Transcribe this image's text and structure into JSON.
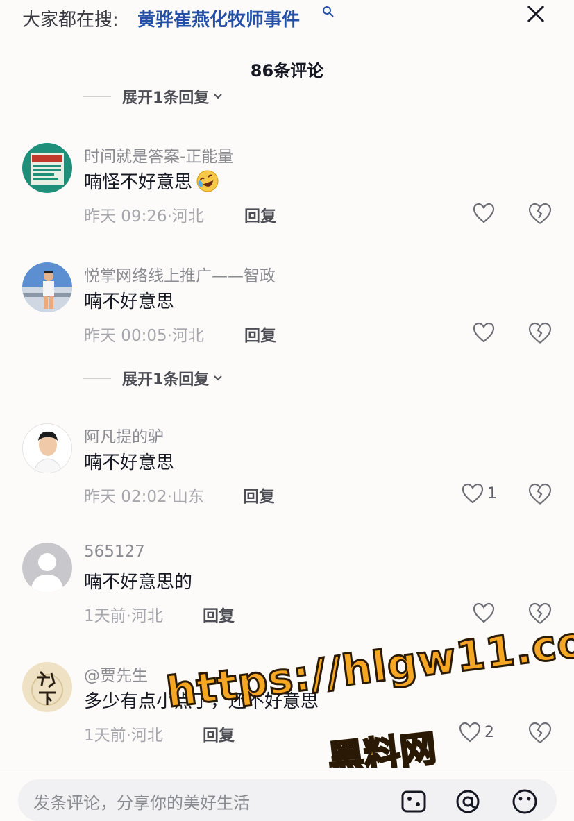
{
  "header": {
    "search_prefix": "大家都在搜:",
    "search_term": "黄骅崔燕化牧师事件",
    "comment_count": "86条评论"
  },
  "top_expand": {
    "label": "展开1条回复"
  },
  "comments": [
    {
      "username": "时间就是答案-正能量",
      "text": "喃怪不好意思",
      "emoji": "rofl-emoji",
      "time": "昨天 09:26",
      "location": "河北",
      "reply_label": "回复",
      "likes": "",
      "avatar": "book-cover-avatar"
    },
    {
      "username": "悦掌网络线上推广——智政",
      "text": "喃不好意思",
      "time": "昨天 00:05",
      "location": "河北",
      "reply_label": "回复",
      "likes": "",
      "avatar": "person-on-yacht-avatar",
      "expand_label": "展开1条回复"
    },
    {
      "username": "阿凡提的驴",
      "text": "喃不好意思",
      "time": "昨天 02:02",
      "location": "山东",
      "reply_label": "回复",
      "likes": "1",
      "avatar": "young-man-portrait-avatar"
    },
    {
      "username": "565127",
      "text": "喃不好意思的",
      "time": "1天前",
      "location": "河北",
      "reply_label": "回复",
      "likes": "",
      "avatar": "default-gray-avatar"
    },
    {
      "username": "@贾先生",
      "text": "多少有点小点了，还不好意思",
      "time": "1天前",
      "location": "河北",
      "reply_label": "回复",
      "likes": "2",
      "avatar": "calligraphy-avatar"
    }
  ],
  "meta_separator": "·",
  "watermark": {
    "url": "https://hlgw11.com",
    "label": "黑料网"
  },
  "input_bar": {
    "placeholder": "发条评论，分享你的美好生活"
  },
  "colors": {
    "accent_link": "#2450a8",
    "watermark": "#f5a623"
  }
}
